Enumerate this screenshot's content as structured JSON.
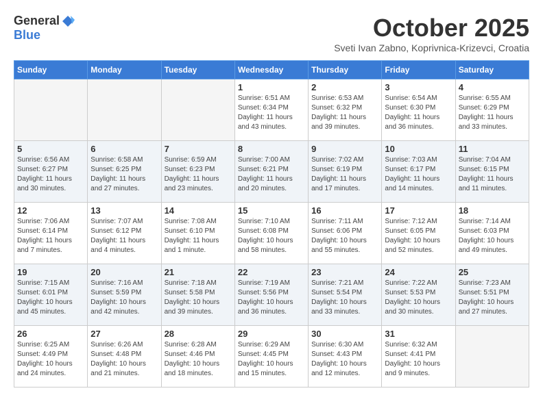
{
  "header": {
    "logo_general": "General",
    "logo_blue": "Blue",
    "month": "October 2025",
    "location": "Sveti Ivan Zabno, Koprivnica-Krizevci, Croatia"
  },
  "weekdays": [
    "Sunday",
    "Monday",
    "Tuesday",
    "Wednesday",
    "Thursday",
    "Friday",
    "Saturday"
  ],
  "weeks": [
    [
      {
        "day": "",
        "info": ""
      },
      {
        "day": "",
        "info": ""
      },
      {
        "day": "",
        "info": ""
      },
      {
        "day": "1",
        "info": "Sunrise: 6:51 AM\nSunset: 6:34 PM\nDaylight: 11 hours\nand 43 minutes."
      },
      {
        "day": "2",
        "info": "Sunrise: 6:53 AM\nSunset: 6:32 PM\nDaylight: 11 hours\nand 39 minutes."
      },
      {
        "day": "3",
        "info": "Sunrise: 6:54 AM\nSunset: 6:30 PM\nDaylight: 11 hours\nand 36 minutes."
      },
      {
        "day": "4",
        "info": "Sunrise: 6:55 AM\nSunset: 6:29 PM\nDaylight: 11 hours\nand 33 minutes."
      }
    ],
    [
      {
        "day": "5",
        "info": "Sunrise: 6:56 AM\nSunset: 6:27 PM\nDaylight: 11 hours\nand 30 minutes."
      },
      {
        "day": "6",
        "info": "Sunrise: 6:58 AM\nSunset: 6:25 PM\nDaylight: 11 hours\nand 27 minutes."
      },
      {
        "day": "7",
        "info": "Sunrise: 6:59 AM\nSunset: 6:23 PM\nDaylight: 11 hours\nand 23 minutes."
      },
      {
        "day": "8",
        "info": "Sunrise: 7:00 AM\nSunset: 6:21 PM\nDaylight: 11 hours\nand 20 minutes."
      },
      {
        "day": "9",
        "info": "Sunrise: 7:02 AM\nSunset: 6:19 PM\nDaylight: 11 hours\nand 17 minutes."
      },
      {
        "day": "10",
        "info": "Sunrise: 7:03 AM\nSunset: 6:17 PM\nDaylight: 11 hours\nand 14 minutes."
      },
      {
        "day": "11",
        "info": "Sunrise: 7:04 AM\nSunset: 6:15 PM\nDaylight: 11 hours\nand 11 minutes."
      }
    ],
    [
      {
        "day": "12",
        "info": "Sunrise: 7:06 AM\nSunset: 6:14 PM\nDaylight: 11 hours\nand 7 minutes."
      },
      {
        "day": "13",
        "info": "Sunrise: 7:07 AM\nSunset: 6:12 PM\nDaylight: 11 hours\nand 4 minutes."
      },
      {
        "day": "14",
        "info": "Sunrise: 7:08 AM\nSunset: 6:10 PM\nDaylight: 11 hours\nand 1 minute."
      },
      {
        "day": "15",
        "info": "Sunrise: 7:10 AM\nSunset: 6:08 PM\nDaylight: 10 hours\nand 58 minutes."
      },
      {
        "day": "16",
        "info": "Sunrise: 7:11 AM\nSunset: 6:06 PM\nDaylight: 10 hours\nand 55 minutes."
      },
      {
        "day": "17",
        "info": "Sunrise: 7:12 AM\nSunset: 6:05 PM\nDaylight: 10 hours\nand 52 minutes."
      },
      {
        "day": "18",
        "info": "Sunrise: 7:14 AM\nSunset: 6:03 PM\nDaylight: 10 hours\nand 49 minutes."
      }
    ],
    [
      {
        "day": "19",
        "info": "Sunrise: 7:15 AM\nSunset: 6:01 PM\nDaylight: 10 hours\nand 45 minutes."
      },
      {
        "day": "20",
        "info": "Sunrise: 7:16 AM\nSunset: 5:59 PM\nDaylight: 10 hours\nand 42 minutes."
      },
      {
        "day": "21",
        "info": "Sunrise: 7:18 AM\nSunset: 5:58 PM\nDaylight: 10 hours\nand 39 minutes."
      },
      {
        "day": "22",
        "info": "Sunrise: 7:19 AM\nSunset: 5:56 PM\nDaylight: 10 hours\nand 36 minutes."
      },
      {
        "day": "23",
        "info": "Sunrise: 7:21 AM\nSunset: 5:54 PM\nDaylight: 10 hours\nand 33 minutes."
      },
      {
        "day": "24",
        "info": "Sunrise: 7:22 AM\nSunset: 5:53 PM\nDaylight: 10 hours\nand 30 minutes."
      },
      {
        "day": "25",
        "info": "Sunrise: 7:23 AM\nSunset: 5:51 PM\nDaylight: 10 hours\nand 27 minutes."
      }
    ],
    [
      {
        "day": "26",
        "info": "Sunrise: 6:25 AM\nSunset: 4:49 PM\nDaylight: 10 hours\nand 24 minutes."
      },
      {
        "day": "27",
        "info": "Sunrise: 6:26 AM\nSunset: 4:48 PM\nDaylight: 10 hours\nand 21 minutes."
      },
      {
        "day": "28",
        "info": "Sunrise: 6:28 AM\nSunset: 4:46 PM\nDaylight: 10 hours\nand 18 minutes."
      },
      {
        "day": "29",
        "info": "Sunrise: 6:29 AM\nSunset: 4:45 PM\nDaylight: 10 hours\nand 15 minutes."
      },
      {
        "day": "30",
        "info": "Sunrise: 6:30 AM\nSunset: 4:43 PM\nDaylight: 10 hours\nand 12 minutes."
      },
      {
        "day": "31",
        "info": "Sunrise: 6:32 AM\nSunset: 4:41 PM\nDaylight: 10 hours\nand 9 minutes."
      },
      {
        "day": "",
        "info": ""
      }
    ]
  ]
}
